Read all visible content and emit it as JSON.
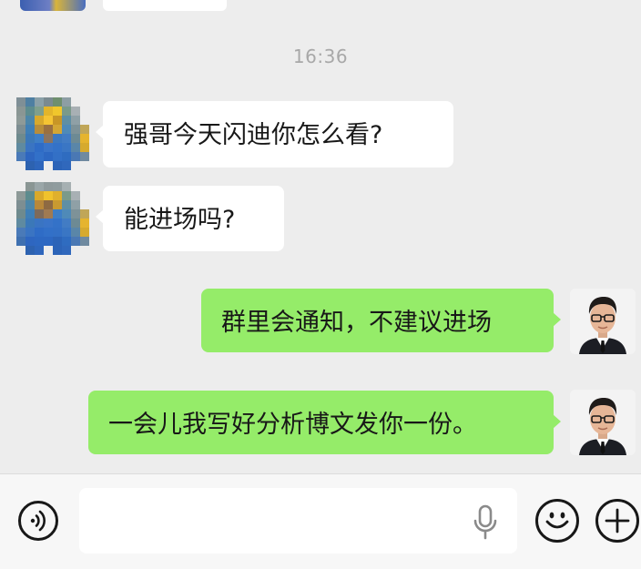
{
  "timestamp": "16:36",
  "messages": [
    {
      "sender": "other",
      "text": "强哥今天闪迪你怎么看?"
    },
    {
      "sender": "other",
      "text": "能进场吗?"
    },
    {
      "sender": "me",
      "text": "群里会通知，不建议进场"
    },
    {
      "sender": "me",
      "text": "一会儿我写好分析博文发你一份。"
    }
  ],
  "input": {
    "value": "",
    "placeholder": ""
  },
  "icons": {
    "voice": "voice-toggle-icon",
    "mic": "microphone-icon",
    "emoji": "emoji-icon",
    "plus": "plus-icon"
  },
  "colors": {
    "background": "#ededed",
    "bubble_in": "#ffffff",
    "bubble_out": "#95ec69",
    "text": "#181818"
  }
}
